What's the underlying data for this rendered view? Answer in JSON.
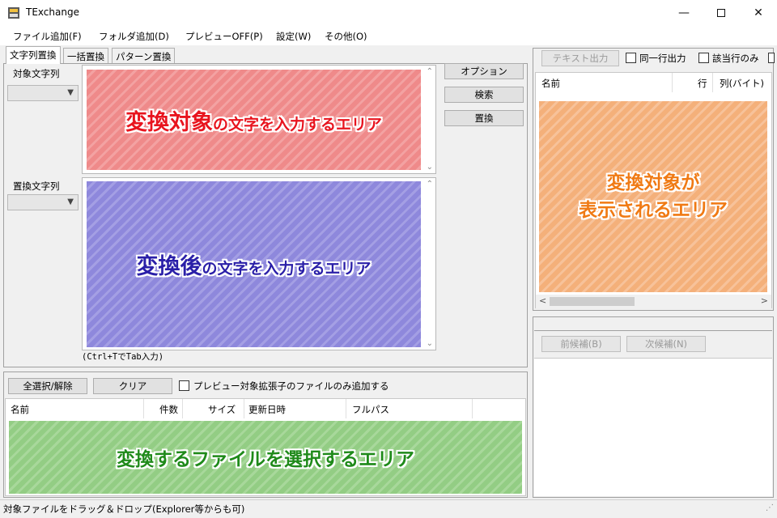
{
  "window": {
    "title": "TExchange"
  },
  "menu": [
    "ファイル追加(F)",
    "フォルダ追加(D)",
    "プレビューOFF(P)",
    "設定(W)",
    "その他(O)"
  ],
  "tabs": [
    "文字列置換",
    "一括置換",
    "パターン置換"
  ],
  "search": {
    "label": "対象文字列"
  },
  "replace": {
    "label": "置換文字列"
  },
  "side_buttons": [
    "オプション",
    "検索",
    "置換"
  ],
  "hint": "(Ctrl+TでTab入力)",
  "overlay_search": {
    "strong": "変換対象",
    "rest": "の文字を入力するエリア"
  },
  "overlay_replace": {
    "strong": "変換後",
    "rest": "の文字を入力するエリア"
  },
  "file_toolbar": {
    "select_all": "全選択/解除",
    "clear": "クリア",
    "preview_only": "プレビュー対象拡張子のファイルのみ追加する"
  },
  "file_columns": [
    "名前",
    "件数",
    "サイズ",
    "更新日時",
    "フルパス"
  ],
  "overlay_files": "変換するファイルを選択するエリア",
  "right_toolbar": {
    "text_output": "テキスト出力",
    "same_line": "同一行出力",
    "matching_only": "該当行のみ"
  },
  "result_columns": [
    "名前",
    "行",
    "列(バイト)"
  ],
  "overlay_results": {
    "line1": "変換対象が",
    "line2": "表示されるエリア"
  },
  "candidates": {
    "prev": "前候補(B)",
    "next": "次候補(N)"
  },
  "status": "対象ファイルをドラッグ＆ドロップ(Explorer等からも可)",
  "colors": {
    "red": "#ef8a8a",
    "blue": "#8e88dc",
    "orange": "#f4b07a",
    "green": "#93cd84"
  }
}
